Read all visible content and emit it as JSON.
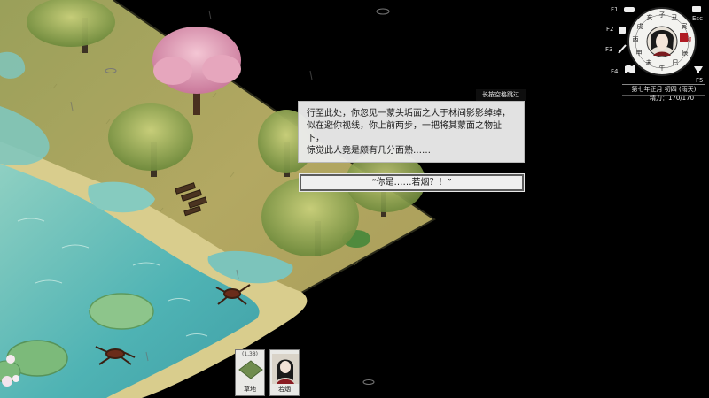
{
  "dialog": {
    "skip_hint": "长按空格跳过",
    "narration_lines": [
      "行至此处，你忽见一蒙头垢面之人于林间影影绰绰，",
      "似在避你视线，你上前两步，一把将其蒙面之物扯下，",
      "惊觉此人竟是颇有几分面熟……"
    ],
    "choice": "“你是……若烟？！”"
  },
  "hud": {
    "hotkeys": [
      "F1",
      "F2",
      "F3",
      "F4",
      "F5"
    ],
    "esc": "Esc",
    "clock_ring_chars": [
      "子",
      "丑",
      "寅",
      "卯",
      "辰",
      "巳",
      "午",
      "未",
      "申",
      "酉",
      "戌",
      "亥"
    ],
    "date": "第七年正月 初四 (雨天)",
    "energy": "精力：170/170"
  },
  "cards": {
    "tile": {
      "coord": "(1,38)",
      "label": "草地"
    },
    "character": {
      "label": "若烟"
    }
  },
  "colors": {
    "grass": "#b8ac64",
    "water": "#5fb9b3",
    "sand": "#d8cb8a",
    "blossom": "#e2a0b8",
    "panel": "#ebebeb",
    "seal_red": "#b01c24"
  }
}
